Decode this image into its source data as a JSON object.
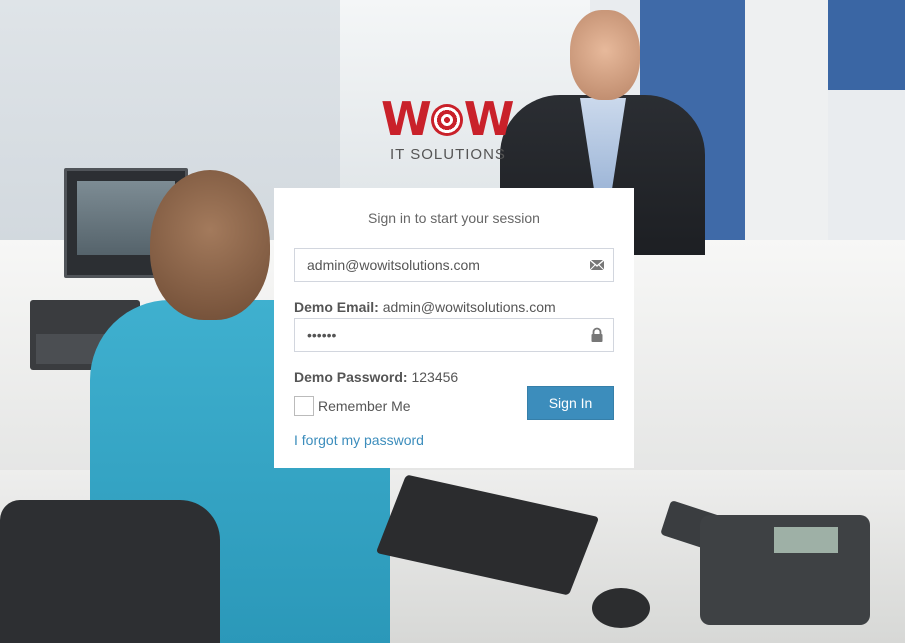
{
  "brand": {
    "logo_word": "W",
    "logo_word_end": "W",
    "subtitle": "IT SOLUTIONS",
    "logo_color": "#c9212a"
  },
  "login": {
    "message": "Sign in to start your session",
    "email": {
      "value": "admin@wowitsolutions.com",
      "icon": "envelope-icon"
    },
    "demo_email": {
      "label": "Demo Email:",
      "value": "admin@wowitsolutions.com"
    },
    "password": {
      "value": "••••••",
      "icon": "lock-icon"
    },
    "demo_password": {
      "label": "Demo Password:",
      "value": "123456"
    },
    "remember_label": "Remember Me",
    "signin_label": "Sign In",
    "forgot_label": "I forgot my password",
    "accent_color": "#3c8dbc"
  }
}
